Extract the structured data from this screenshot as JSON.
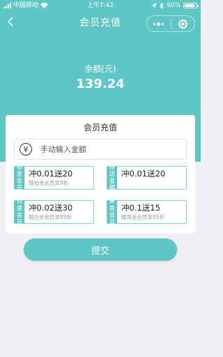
{
  "status_bar": {
    "carrier": "中国移动",
    "time": "上午7:42",
    "battery": "90%",
    "battery_level": 0.9
  },
  "nav": {
    "title": "会员充值"
  },
  "balance": {
    "label": "余额(元)",
    "value": "139.24"
  },
  "recharge_card": {
    "title": "会员充值",
    "amount_placeholder": "手动输入金额",
    "packages": [
      {
        "tag": [
          "铂",
          "金",
          "会",
          "员"
        ],
        "main": "冲0.01送20",
        "sub": "赠铂金会员享9折"
      },
      {
        "tag": [
          "赠",
          "送",
          "金",
          "额"
        ],
        "main": "冲0.01送20",
        "sub": ""
      },
      {
        "tag": [
          "白",
          "金",
          "会",
          "员"
        ],
        "main": "冲0.02送30",
        "sub": "赠白金会员享85折"
      },
      {
        "tag": [
          "黄",
          "金",
          "会",
          "员"
        ],
        "main": "冲0.1送15",
        "sub": "赠黄金会员享95折"
      }
    ]
  },
  "submit_label": "提交",
  "colors": {
    "accent": "#5ec6c4",
    "background": "#efeff4"
  },
  "icons": {
    "back": "chevron-left-icon",
    "more": "more-dots-icon",
    "close": "target-icon",
    "currency": "yen-icon"
  }
}
